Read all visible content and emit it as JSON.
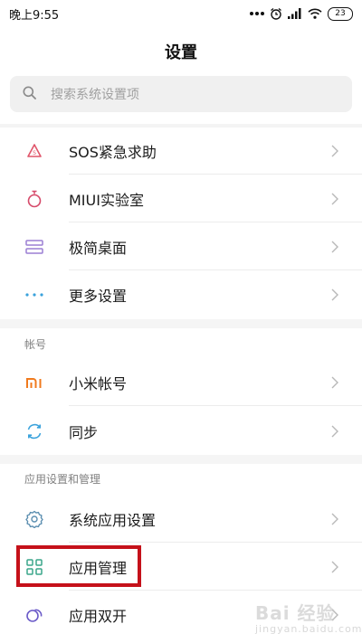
{
  "status_bar": {
    "time": "晚上9:55",
    "battery": "23"
  },
  "header": {
    "title": "设置"
  },
  "search": {
    "placeholder": "搜索系统设置项"
  },
  "group_top": {
    "items": [
      {
        "label": "SOS紧急求助",
        "icon": "sos-icon"
      },
      {
        "label": "MIUI实验室",
        "icon": "lab-flask-icon"
      },
      {
        "label": "极简桌面",
        "icon": "simple-desktop-icon"
      },
      {
        "label": "更多设置",
        "icon": "more-dots-icon"
      }
    ]
  },
  "group_account": {
    "header": "帐号",
    "items": [
      {
        "label": "小米帐号",
        "icon": "mi-logo-icon"
      },
      {
        "label": "同步",
        "icon": "sync-icon"
      }
    ]
  },
  "group_apps": {
    "header": "应用设置和管理",
    "items": [
      {
        "label": "系统应用设置",
        "icon": "gear-icon"
      },
      {
        "label": "应用管理",
        "icon": "app-grid-icon"
      },
      {
        "label": "应用双开",
        "icon": "dual-apps-icon"
      }
    ]
  },
  "watermark": {
    "text": "Bai 经验",
    "sub": "jingyan.baidu.com"
  },
  "colors": {
    "highlight": "#c5111a",
    "sos": "#e0556a",
    "account": "#f07a1d",
    "sync": "#3aa2dc",
    "gear": "#5b8eb0",
    "grid": "#3aa58a"
  }
}
